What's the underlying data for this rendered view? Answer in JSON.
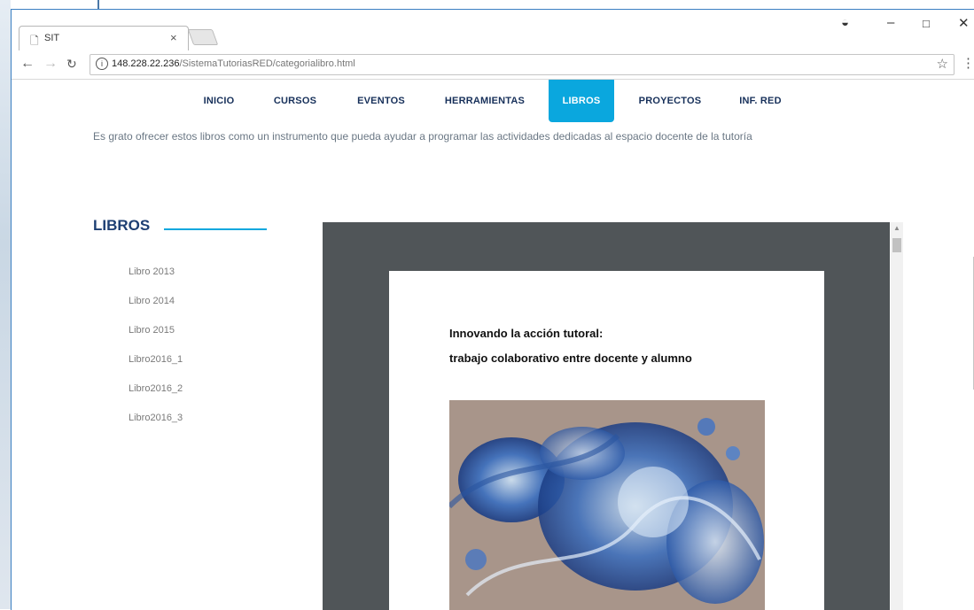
{
  "browser": {
    "tab_title": "SIT",
    "url_host": "148.228.22.236",
    "url_path": "/SistemaTutoriasRED/categorialibro.html"
  },
  "nav": {
    "items": [
      "INICIO",
      "CURSOS",
      "EVENTOS",
      "HERRAMIENTAS",
      "LIBROS",
      "PROYECTOS",
      "INF. RED"
    ],
    "active": "LIBROS"
  },
  "intro_text": "Es grato ofrecer estos libros como un instrumento que pueda ayudar a programar las actividades dedicadas al espacio docente de la tutoría",
  "sidebar": {
    "title": "LIBROS",
    "items": [
      "Libro 2013",
      "Libro 2014",
      "Libro 2015",
      "Libro2016_1",
      "Libro2016_2",
      "Libro2016_3"
    ]
  },
  "document": {
    "title_line1": "Innovando la acción tutoral:",
    "title_line2": "trabajo colaborativo entre docente y alumno"
  },
  "colors": {
    "accent": "#0aa7de",
    "nav_text": "#17305a",
    "viewer_bg": "#505558"
  }
}
